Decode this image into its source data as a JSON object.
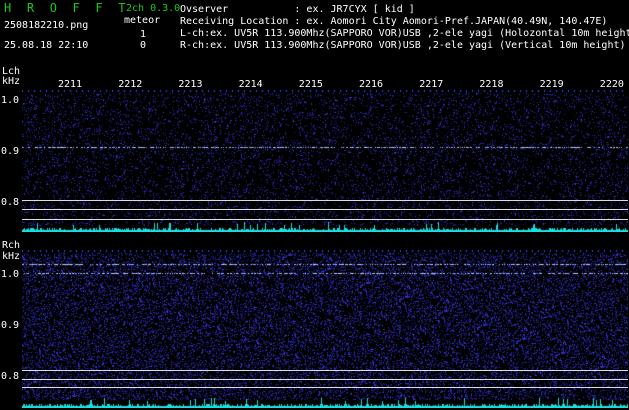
{
  "header": {
    "logo": "H R O F F T",
    "channels": "2ch 0.3.0",
    "filename": "2508182210.png",
    "meteor_label": "meteor",
    "meteor_l": "1",
    "meteor_r": "0",
    "datetime": "25.08.18 22:10",
    "observer": "Ovserver           : ex. JR7CYX [ kid ]",
    "location": "Receiving Location : ex. Aomori City Aomori-Pref.JAPAN(40.49N, 140.47E)",
    "lch_info": "L-ch:ex. UV5R 113.900Mhz(SAPPORO VOR)USB ,2-ele yagi (Holozontal 10m height)",
    "rch_info": "R-ch:ex. UV5R 113.900Mhz(SAPPORO VOR)USB ,2-ele yagi (Vertical 10m height)"
  },
  "axis": {
    "lch_label": "Lch",
    "unit": "kHz",
    "rch_label": "Rch",
    "time_ticks": [
      "2211",
      "2212",
      "2213",
      "2214",
      "2215",
      "2216",
      "2217",
      "2218",
      "2219",
      "2220"
    ],
    "lch_freq_ticks": [
      "1.0",
      "0.9",
      "0.8"
    ],
    "rch_freq_ticks": [
      "1.0",
      "0.9",
      "0.8"
    ]
  },
  "colors": {
    "background": "#000000",
    "noise": "#2a2ab4",
    "carrier": "#a0b8ff",
    "level_bar": "#19e0e0",
    "green_text": "#19c819"
  }
}
